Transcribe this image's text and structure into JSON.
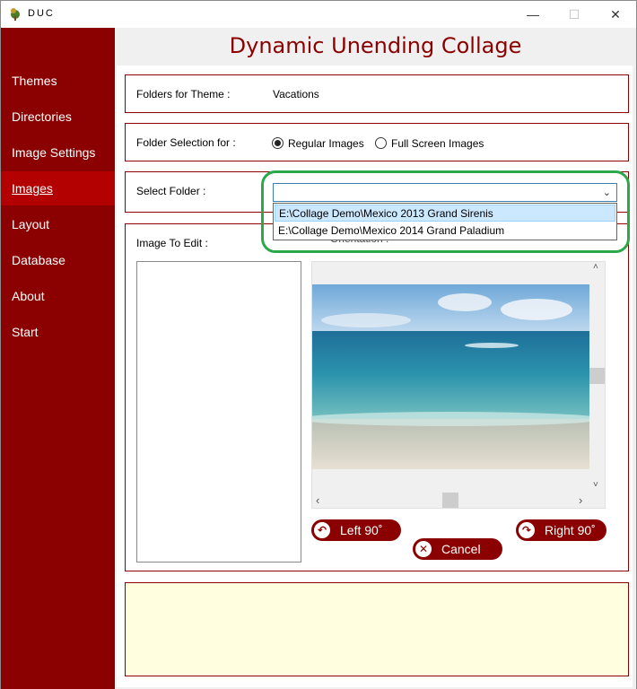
{
  "window": {
    "title": "DUC",
    "minimize_glyph": "—",
    "maximize_glyph": "☐",
    "close_glyph": "✕"
  },
  "sidebar": {
    "items": [
      {
        "label": "Themes"
      },
      {
        "label": "Directories"
      },
      {
        "label": "Image Settings"
      },
      {
        "label": "Images"
      },
      {
        "label": "Layout"
      },
      {
        "label": "Database"
      },
      {
        "label": "About"
      },
      {
        "label": "Start"
      }
    ],
    "active": "Images"
  },
  "header": {
    "title": "Dynamic Unending Collage"
  },
  "folders_for_theme": {
    "label": "Folders for Theme :",
    "value": "Vacations"
  },
  "folder_selection": {
    "label": "Folder Selection for :",
    "options": [
      "Regular Images",
      "Full Screen Images"
    ],
    "selected": "Regular Images"
  },
  "select_folder": {
    "label": "Select Folder :",
    "current_value": "",
    "options": [
      "E:\\Collage Demo\\Mexico 2013 Grand Sirenis",
      "E:\\Collage Demo\\Mexico 2014 Grand Paladium"
    ],
    "highlighted": "E:\\Collage Demo\\Mexico 2013 Grand Sirenis",
    "arrow_glyph": "⌄"
  },
  "image_edit": {
    "label": "Image To Edit :",
    "orientation_label": "Orientation :"
  },
  "buttons": {
    "left": {
      "label": "Left 90˚",
      "icon_glyph": "↶"
    },
    "right": {
      "label": "Right 90˚",
      "icon_glyph": "↷"
    },
    "cancel": {
      "label": "Cancel",
      "icon_glyph": "✕"
    }
  },
  "scroll_glyphs": {
    "up": "˄",
    "down": "˅",
    "left": "‹",
    "right": "›"
  },
  "colors": {
    "accent": "#8b0000",
    "active_nav": "#b30000",
    "highlight_ring": "#2aa84a",
    "note_panel": "#ffffe0"
  }
}
